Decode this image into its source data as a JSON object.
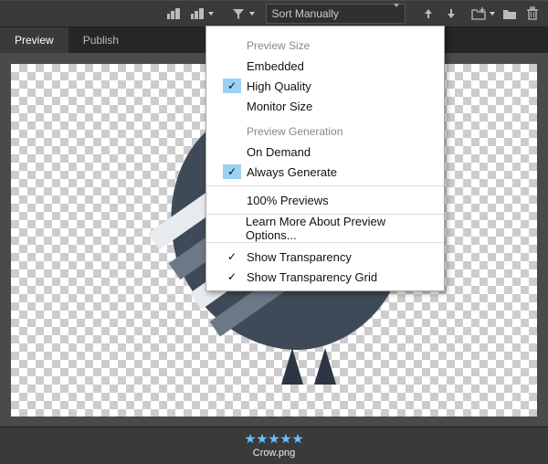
{
  "toolbar": {
    "sort_label": "Sort Manually"
  },
  "tabs": {
    "preview": "Preview",
    "publish": "Publish"
  },
  "menu": {
    "hdr_size": "Preview Size",
    "embedded": "Embedded",
    "high_quality": "High Quality",
    "monitor_size": "Monitor Size",
    "hdr_gen": "Preview Generation",
    "on_demand": "On Demand",
    "always_generate": "Always Generate",
    "full_previews": "100% Previews",
    "learn_more": "Learn More About Preview Options...",
    "show_trans": "Show Transparency",
    "show_trans_grid": "Show Transparency Grid"
  },
  "footer": {
    "filename": "Crow.png"
  }
}
